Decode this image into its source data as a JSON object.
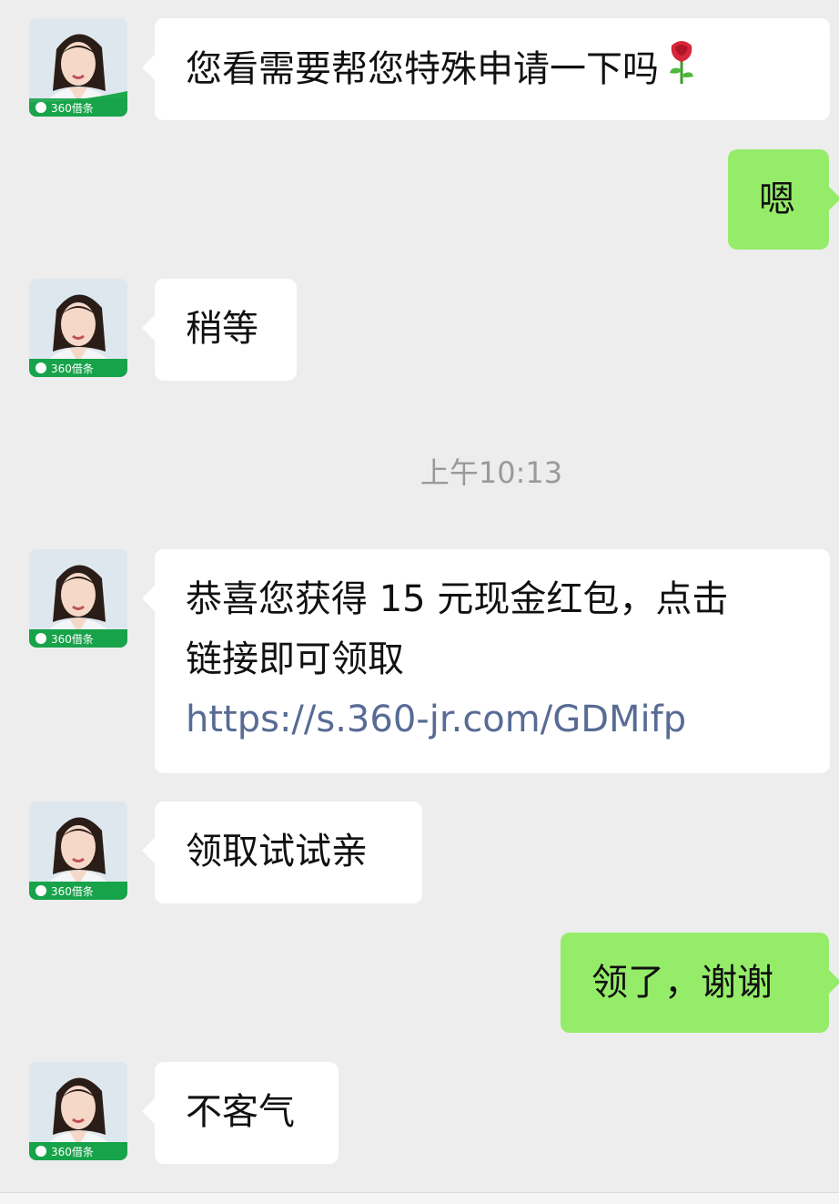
{
  "chat": {
    "messages": [
      {
        "direction": "incoming",
        "text": "您看需要帮您特殊申请一下吗",
        "emoji": "rose"
      },
      {
        "direction": "outgoing",
        "text": "嗯"
      },
      {
        "direction": "incoming",
        "text": "稍等"
      },
      {
        "type": "timestamp",
        "text": "上午10:13"
      },
      {
        "direction": "incoming",
        "line1": "恭喜您获得 15 元现金红包，点击",
        "line2": "链接即可领取",
        "link": "https://s.360-jr.com/GDMifp"
      },
      {
        "direction": "incoming",
        "text": "领取试试亲"
      },
      {
        "direction": "outgoing",
        "text": "领了，谢谢"
      },
      {
        "direction": "incoming",
        "text": "不客气"
      }
    ],
    "avatar_badge": "360借条"
  },
  "colors": {
    "background": "#ededed",
    "incoming_bubble": "#ffffff",
    "outgoing_bubble": "#95ec69",
    "link": "#576b95",
    "badge_green": "#07a35a"
  }
}
